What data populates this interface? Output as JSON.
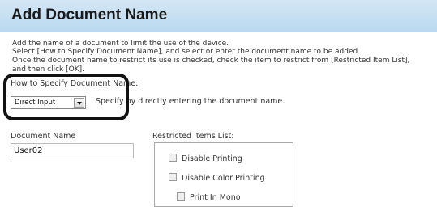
{
  "title": "Add Document Name",
  "instructions": [
    "Add the name of a document to limit the use of the device.",
    "Select [How to Specify Document Name], and select or enter the document name to be added.",
    "Once the document name to restrict its use is checked, check the item to restrict from [Restricted Item List],",
    "and then click [OK]."
  ],
  "specify": {
    "label": "How to Specify Document Name:",
    "selected": "Direct Input",
    "hint": "Specify by directly entering the document name."
  },
  "document_name": {
    "label": "Document Name",
    "value": "User02"
  },
  "restricted": {
    "label": "Restricted Items List:",
    "items": [
      "Disable Printing",
      "Disable Color Printing",
      "Print In Mono"
    ]
  }
}
